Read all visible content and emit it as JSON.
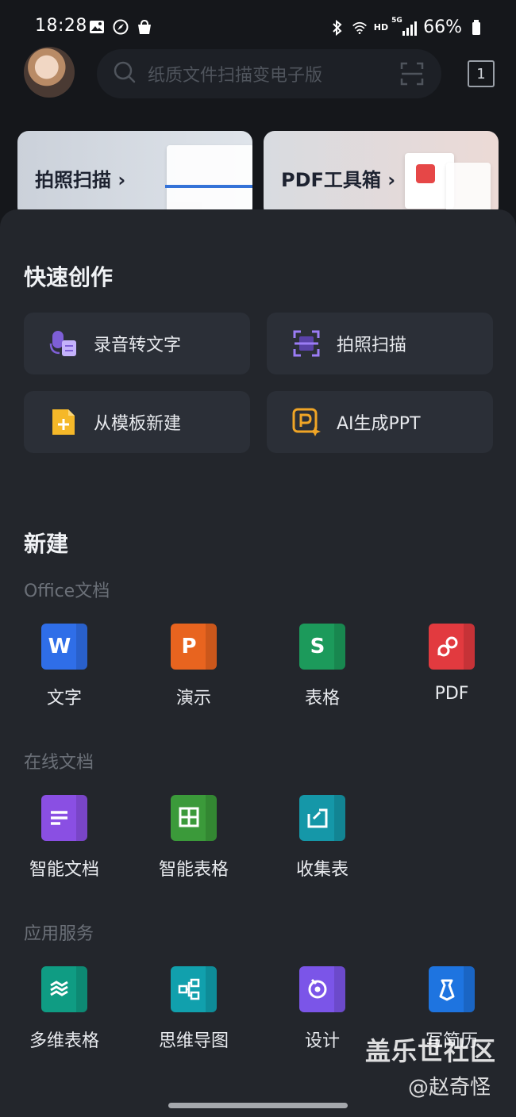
{
  "status_bar": {
    "time": "18:28",
    "battery": "66%",
    "net_label": "HD",
    "sig_label": "5G"
  },
  "search": {
    "placeholder": "纸质文件扫描变电子版",
    "tab_count": "1"
  },
  "top_cards": [
    {
      "label": "拍照扫描 ›"
    },
    {
      "label": "PDF工具箱 ›"
    }
  ],
  "quick_create": {
    "title": "快速创作",
    "items": [
      {
        "label": "录音转文字",
        "icon": "voice-to-text-icon",
        "color": "#9d7cf0"
      },
      {
        "label": "拍照扫描",
        "icon": "scan-icon",
        "color": "#8e6cf2"
      },
      {
        "label": "从模板新建",
        "icon": "template-icon",
        "color": "#f5b829"
      },
      {
        "label": "AI生成PPT",
        "icon": "ai-ppt-icon",
        "color": "#f0a526"
      }
    ]
  },
  "new_section": {
    "title": "新建",
    "office": {
      "title": "Office文档",
      "items": [
        {
          "label": "文字",
          "glyph": "W",
          "color": "#2f6ee8"
        },
        {
          "label": "演示",
          "glyph": "P",
          "color": "#e8641f"
        },
        {
          "label": "表格",
          "glyph": "S",
          "color": "#1c9a5b"
        },
        {
          "label": "PDF",
          "glyph": "",
          "color": "#e23a3f"
        }
      ]
    },
    "online": {
      "title": "在线文档",
      "items": [
        {
          "label": "智能文档",
          "color": "#8a4fe3"
        },
        {
          "label": "智能表格",
          "color": "#3b9a3a"
        },
        {
          "label": "收集表",
          "color": "#1597a8"
        }
      ]
    },
    "services": {
      "title": "应用服务",
      "items": [
        {
          "label": "多维表格",
          "color": "#0f9c83"
        },
        {
          "label": "思维导图",
          "color": "#11a0ad"
        },
        {
          "label": "设计",
          "color": "#7b55e8"
        },
        {
          "label": "写简历",
          "color": "#1e74e0"
        }
      ]
    }
  },
  "watermark": {
    "line1": "盖乐世社区",
    "line2": "@赵奇怪"
  }
}
